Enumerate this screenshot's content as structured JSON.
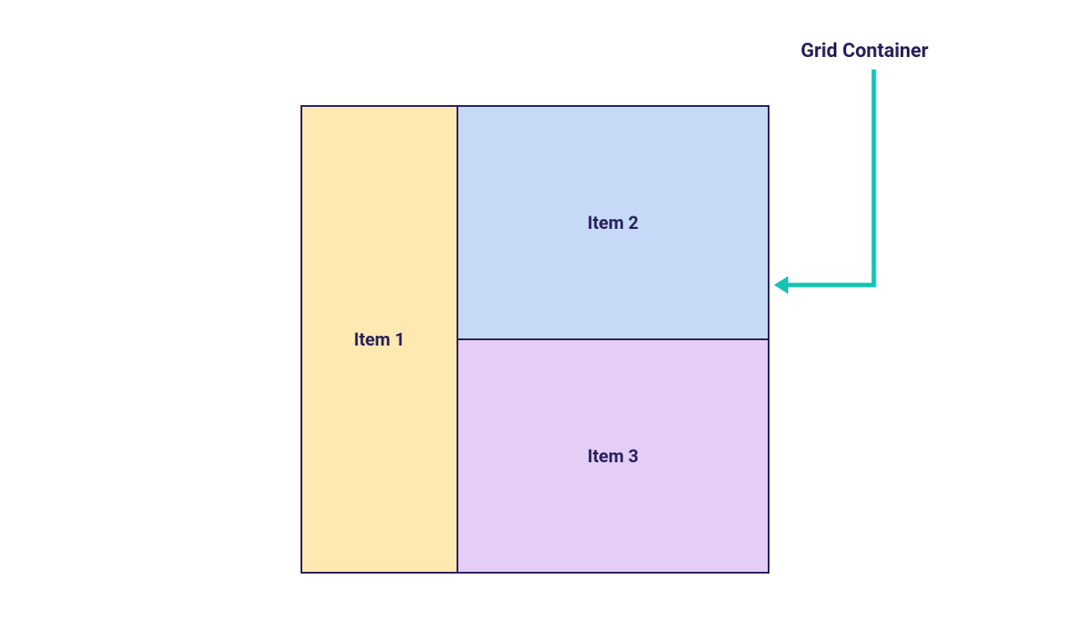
{
  "diagram": {
    "annotation_label": "Grid Container",
    "items": {
      "item1_label": "Item 1",
      "item2_label": "Item 2",
      "item3_label": "Item 3"
    },
    "colors": {
      "item1_bg": "#fee9b2",
      "item2_bg": "#c6d9f7",
      "item3_bg": "#e4cdf6",
      "border": "#27205a",
      "arrow": "#13c4b4",
      "text": "#27205a"
    }
  }
}
